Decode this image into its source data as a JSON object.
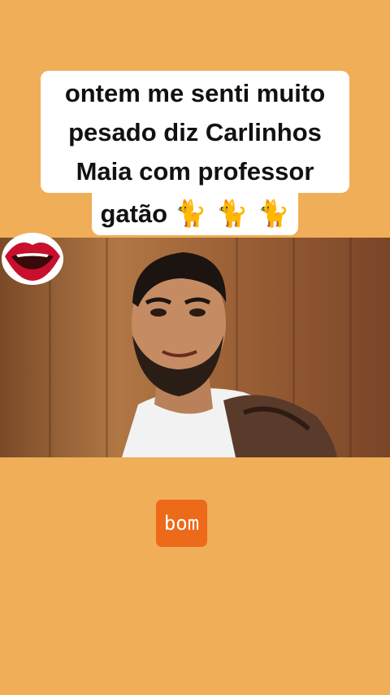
{
  "caption": {
    "line1": "ontem me senti muito",
    "line2": "pesado diz Carlinhos",
    "line3": "Maia com professor",
    "line4_text": "gatão",
    "line4_emojis": "🐈 🐈 🐈"
  },
  "video": {
    "subject": "man-with-beard-white-tank-top"
  },
  "sticker": {
    "icon": "lips-icon"
  },
  "badge": {
    "label": "bom"
  },
  "colors": {
    "background": "#EFAE57",
    "badge": "#EC6A1A",
    "caption_bg": "#FFFFFF",
    "lips_red": "#C8102E"
  }
}
